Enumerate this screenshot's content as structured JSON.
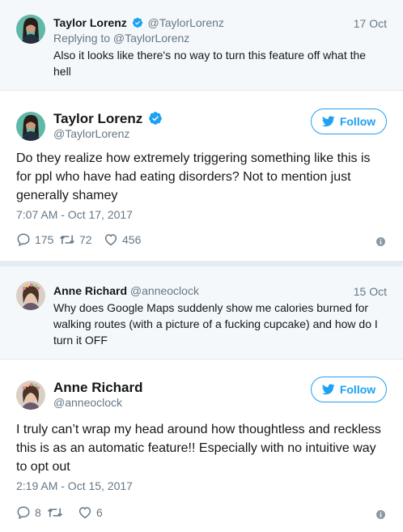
{
  "thread1": {
    "reply": {
      "name": "Taylor Lorenz",
      "handle": "@TaylorLorenz",
      "date": "17 Oct",
      "replying_to": "Replying to @TaylorLorenz",
      "text": "Also it looks like there's no way to turn this feature off what the hell"
    },
    "main": {
      "name": "Taylor Lorenz",
      "handle": "@TaylorLorenz",
      "follow_label": "Follow",
      "text": "Do they realize how extremely triggering something like this is for ppl who have had eating disorders? Not to mention just generally shamey",
      "timestamp": "7:07 AM - Oct 17, 2017",
      "replies": "175",
      "retweets": "72",
      "likes": "456"
    }
  },
  "thread2": {
    "reply": {
      "name": "Anne Richard",
      "handle": "@anneoclock",
      "date": "15 Oct",
      "text": "Why does Google Maps suddenly show me calories burned for walking routes (with a picture of a fucking cupcake) and how do I turn it OFF"
    },
    "main": {
      "name": "Anne Richard",
      "handle": "@anneoclock",
      "follow_label": "Follow",
      "text": "I truly can’t wrap my head around how thoughtless and reckless this is as an automatic feature!! Especially with no intuitive way to opt out",
      "timestamp": "2:19 AM - Oct 15, 2017",
      "replies": "8",
      "retweets": "",
      "likes": "6"
    }
  },
  "colors": {
    "twitter_blue": "#1da1f2",
    "secondary_text": "#657786",
    "reply_bg": "#f5f8fa"
  },
  "icons": [
    "verified-badge-icon",
    "twitter-bird-icon",
    "reply-icon",
    "retweet-icon",
    "like-icon",
    "info-icon"
  ]
}
